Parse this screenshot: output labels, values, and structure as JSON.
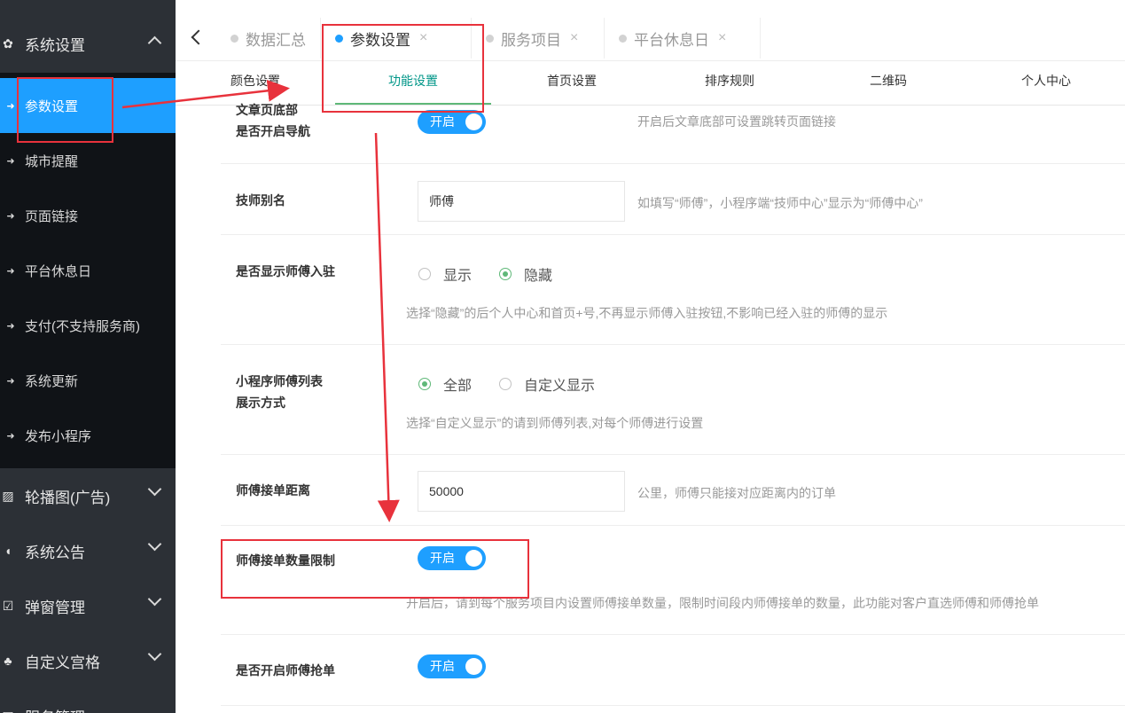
{
  "sidebar": {
    "groups_top": [
      {
        "label": "系统设置",
        "icon": "gear-icon",
        "glyph": "✿"
      }
    ],
    "items": [
      {
        "label": "参数设置",
        "active": true
      },
      {
        "label": "城市提醒"
      },
      {
        "label": "页面链接"
      },
      {
        "label": "平台休息日"
      },
      {
        "label": "支付(不支持服务商)"
      },
      {
        "label": "系统更新"
      },
      {
        "label": "发布小程序"
      }
    ],
    "groups_bottom": [
      {
        "label": "轮播图(广告)",
        "icon": "image-icon",
        "glyph": "▨"
      },
      {
        "label": "系统公告",
        "icon": "speaker-icon",
        "glyph": "◖"
      },
      {
        "label": "弹窗管理",
        "icon": "checkbox-icon",
        "glyph": "☑"
      },
      {
        "label": "自定义宫格",
        "icon": "sitemap-icon",
        "glyph": "♣"
      },
      {
        "label": "服务管理",
        "icon": "list-icon",
        "glyph": "▤"
      }
    ],
    "item_glyph": "➜"
  },
  "tabs": [
    {
      "label": "数据汇总",
      "active": false,
      "closable": false
    },
    {
      "label": "参数设置",
      "active": true,
      "closable": true
    },
    {
      "label": "服务项目",
      "active": false,
      "closable": true
    },
    {
      "label": "平台休息日",
      "active": false,
      "closable": true
    }
  ],
  "close_glyph": "×",
  "subtabs": [
    "颜色设置",
    "功能设置",
    "首页设置",
    "排序规则",
    "二维码",
    "个人中心"
  ],
  "form": {
    "nav_label_1": "文章页底部",
    "nav_label_2": "是否开启导航",
    "nav_switch": "开启",
    "nav_hint": "开启后文章底部可设置跳转页面链接",
    "alias_label": "技师别名",
    "alias_value": "师傅",
    "alias_hint": "如填写“师傅”，小程序端“技师中心”显示为“师傅中心”",
    "entry_label": "是否显示师傅入驻",
    "entry_opt_show": "显示",
    "entry_opt_hide": "隐藏",
    "entry_hint": "选择“隐藏”的后个人中心和首页+号,不再显示师傅入驻按钮,不影响已经入驻的师傅的显示",
    "list_label_1": "小程序师傅列表",
    "list_label_2": "展示方式",
    "list_opt_all": "全部",
    "list_opt_custom": "自定义显示",
    "list_hint": "选择“自定义显示”的请到师傅列表,对每个师傅进行设置",
    "distance_label": "师傅接单距离",
    "distance_value": "50000",
    "distance_hint": "公里，师傅只能接对应距离内的订单",
    "limit_label": "师傅接单数量限制",
    "limit_switch": "开启",
    "limit_hint": "开启后，请到每个服务项目内设置师傅接单数量，限制时间段内师傅接单的数量，此功能对客户直选师傅和师傅抢单",
    "grab_label": "是否开启师傅抢单",
    "grab_switch": "开启"
  },
  "colors": {
    "accent": "#1e9fff",
    "sidebar_bg": "#2c3036",
    "submenu_bg": "#101317",
    "active_subtab": "#009688",
    "annotation": "#e8323c"
  }
}
